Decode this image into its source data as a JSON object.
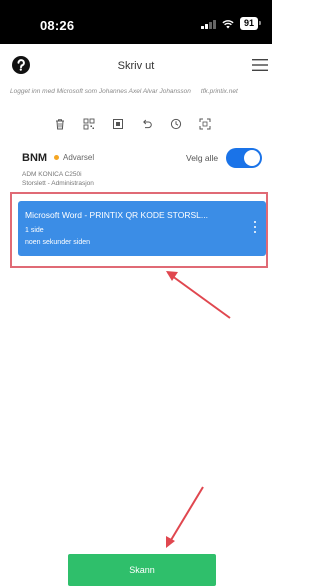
{
  "status_bar": {
    "time": "08:26",
    "battery": "91"
  },
  "header": {
    "title": "Skriv ut"
  },
  "login_info": {
    "text": "Logget inn med Microsoft som Johannes Axel Alvar Johansson",
    "domain": "tfk.printix.net"
  },
  "toolbar": {
    "icons": [
      "trash-icon",
      "qr-code-icon",
      "print-icon",
      "undo-icon",
      "clock-icon",
      "scan-icon"
    ]
  },
  "printer": {
    "name": "BNM",
    "status": "Advarsel",
    "status_color": "#f5a623",
    "model": "ADM KONICA C250i",
    "location": "Storslett - Administrasjon",
    "select_all_label": "Velg alle",
    "select_all_on": true
  },
  "job": {
    "title": "Microsoft Word - PRINTIX QR KODE STORSL...",
    "pages": "1 side",
    "time": "noen sekunder siden"
  },
  "actions": {
    "scan_label": "Skann"
  },
  "colors": {
    "accent": "#1a73e8",
    "job_card": "#3b8de6",
    "scan_button": "#2fbf6b",
    "annotation": "#e06a75"
  }
}
